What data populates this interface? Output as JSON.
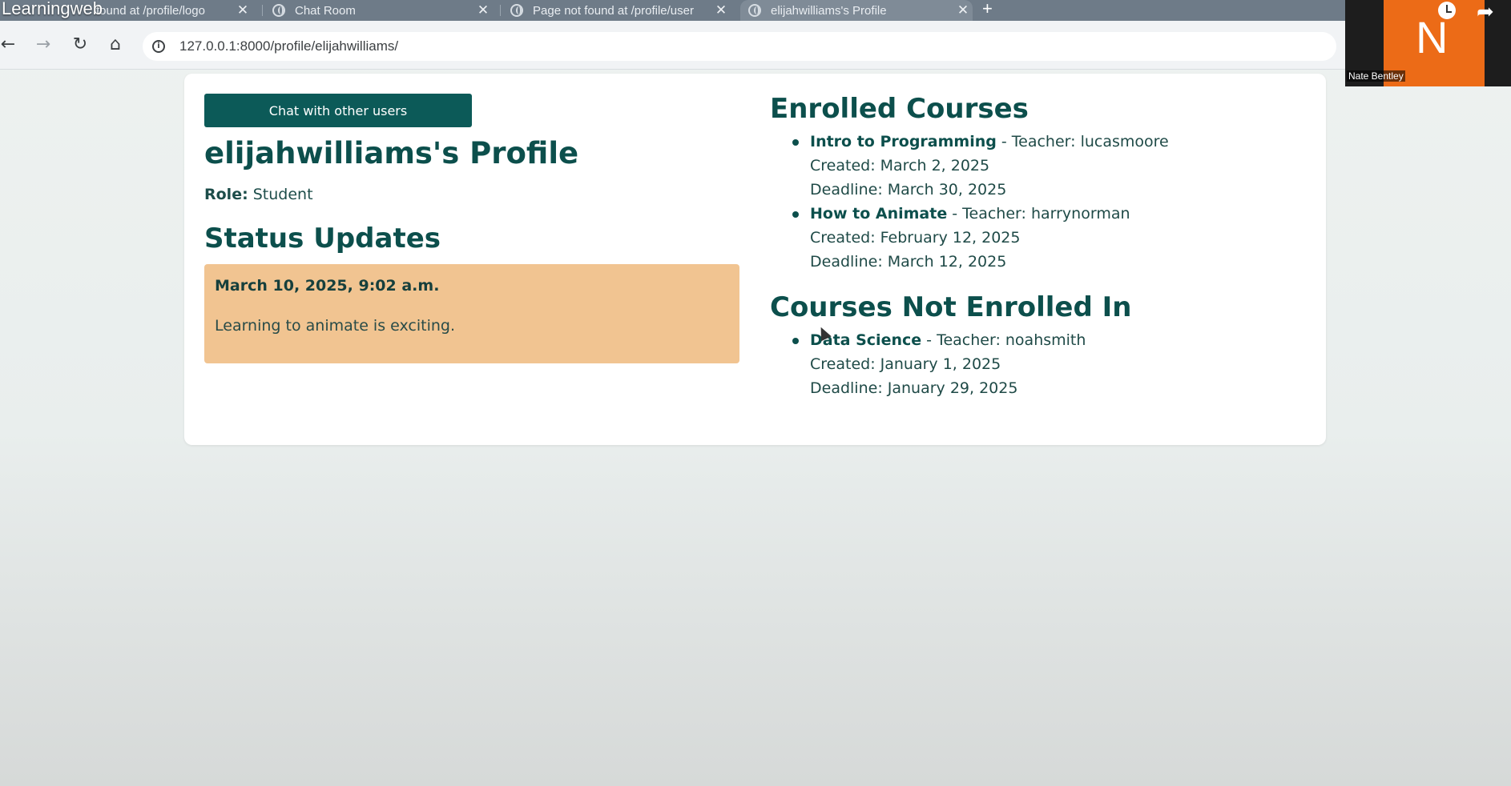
{
  "overlay": {
    "title": "Learningweb"
  },
  "browser": {
    "tabs": [
      {
        "title": "found at /profile/logo",
        "close": "✕"
      },
      {
        "title": "Chat Room",
        "close": "✕"
      },
      {
        "title": "Page not found at /profile/user",
        "close": "✕"
      },
      {
        "title": "elijahwilliams's Profile",
        "close": "✕"
      }
    ],
    "new_tab": "+",
    "url": "127.0.0.1:8000/profile/elijahwilliams/",
    "icons": [
      "back-icon",
      "forward-icon",
      "reload-icon",
      "home-icon",
      "info-icon"
    ]
  },
  "webcam": {
    "initial": "N",
    "name": "Nate Bentley"
  },
  "profile": {
    "chat_button": "Chat with other users",
    "title": "elijahwilliams's Profile",
    "role_label": "Role:",
    "role_value": "Student",
    "status_heading": "Status Updates",
    "status_updates": [
      {
        "date": "March 10, 2025, 9:02 a.m.",
        "text": "Learning to animate is exciting."
      }
    ]
  },
  "enrolled": {
    "heading": "Enrolled Courses",
    "courses": [
      {
        "name": "Intro to Programming",
        "teacher": " - Teacher: lucasmoore",
        "created": "Created: March 2, 2025",
        "deadline": "Deadline: March 30, 2025"
      },
      {
        "name": "How to Animate",
        "teacher": " - Teacher: harrynorman",
        "created": "Created: February 12, 2025",
        "deadline": "Deadline: March 12, 2025"
      }
    ]
  },
  "not_enrolled": {
    "heading": "Courses Not Enrolled In",
    "courses": [
      {
        "name": "Data Science",
        "teacher": " - Teacher: noahsmith",
        "created": "Created: January 1, 2025",
        "deadline": "Deadline: January 29, 2025"
      }
    ]
  },
  "colors": {
    "accent": "#0c5a58",
    "heading": "#0c4f4c",
    "status_bg": "#f1c491"
  }
}
